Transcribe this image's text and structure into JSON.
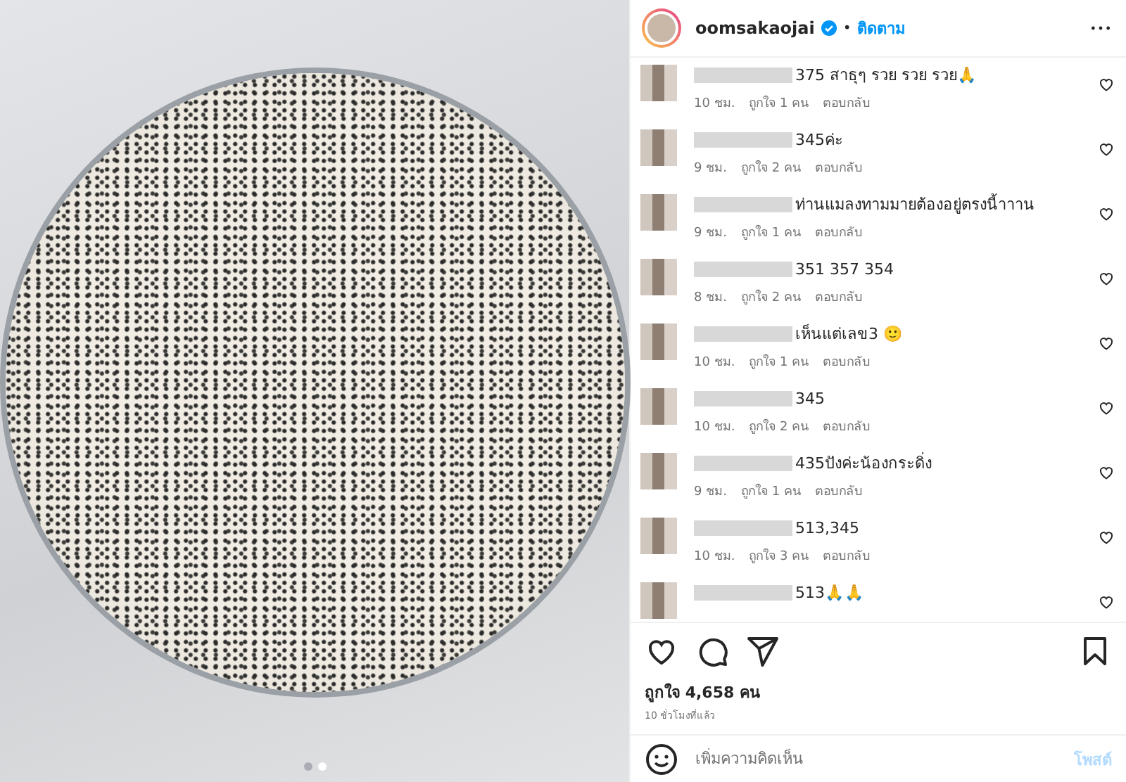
{
  "carousel": [
    {
      "selected": false
    },
    {
      "selected": true
    }
  ],
  "header": {
    "username": "oomsakaojai",
    "verified": true,
    "separator": "•",
    "follow": "ติดตาม"
  },
  "comments": [
    {
      "text": "375 สาธุๆ รวย รวย รวย🙏",
      "time": "10 ชม.",
      "likes": "ถูกใจ 1 คน",
      "reply": "ตอบกลับ"
    },
    {
      "text": "345ค่ะ",
      "time": "9 ชม.",
      "likes": "ถูกใจ 2 คน",
      "reply": "ตอบกลับ"
    },
    {
      "text": "ท่านแมลงทามมายต้องอยู่ตรงนี้าาาน",
      "time": "9 ชม.",
      "likes": "ถูกใจ 1 คน",
      "reply": "ตอบกลับ"
    },
    {
      "text": "351 357 354",
      "time": "8 ชม.",
      "likes": "ถูกใจ 2 คน",
      "reply": "ตอบกลับ"
    },
    {
      "text": "เห็นแต่เลข3 🙂",
      "time": "10 ชม.",
      "likes": "ถูกใจ 1 คน",
      "reply": "ตอบกลับ"
    },
    {
      "text": "345",
      "time": "10 ชม.",
      "likes": "ถูกใจ 2 คน",
      "reply": "ตอบกลับ"
    },
    {
      "text": "435ปังค่ะน้องกระดิ่ง",
      "time": "9 ชม.",
      "likes": "ถูกใจ 1 คน",
      "reply": "ตอบกลับ"
    },
    {
      "text": "513,345",
      "time": "10 ชม.",
      "likes": "ถูกใจ 3 คน",
      "reply": "ตอบกลับ"
    },
    {
      "text": "513🙏🙏"
    }
  ],
  "likes": "ถูกใจ 4,658 คน",
  "posted": "10 ชั่วโมงที่แล้ว",
  "composer": {
    "placeholder": "เพิ่มความคิดเห็น",
    "post_button": "โพสต์",
    "disabled": true
  }
}
